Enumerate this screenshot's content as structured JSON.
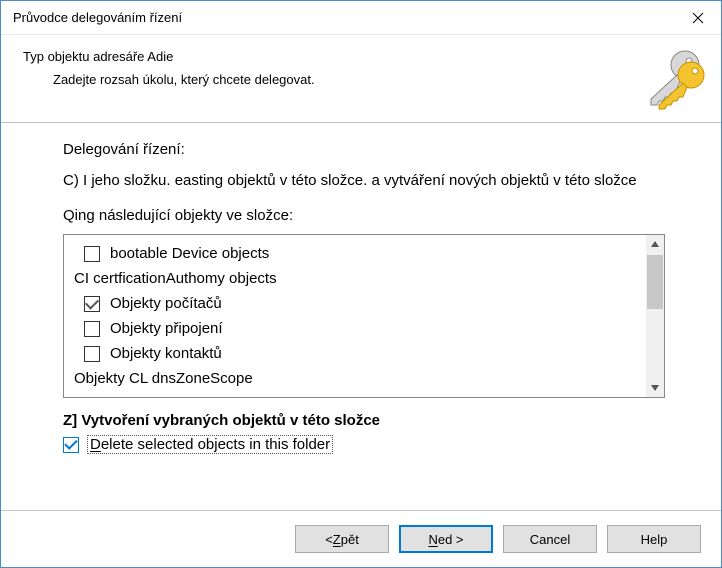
{
  "titlebar": {
    "title": "Průvodce delegováním řízení"
  },
  "header": {
    "title": "Typ objektu adresáře Adie",
    "subtitle": "Zadejte rozsah úkolu, který chcete delegovat."
  },
  "content": {
    "line1": "Delegování řízení:",
    "line2": "C) I jeho složku. easting objektů v této složce. a vytváření nových objektů v této složce",
    "line3": "Qing následující objekty ve složce:",
    "list": [
      {
        "label": "bootable Device objects",
        "checked": false,
        "has_cb": true
      },
      {
        "label": "CI certficationAuthomy objects",
        "checked": false,
        "has_cb": false
      },
      {
        "label": "Objekty počítačů",
        "checked": true,
        "has_cb": true
      },
      {
        "label": "Objekty připojení",
        "checked": false,
        "has_cb": true
      },
      {
        "label": "Objekty kontaktů",
        "checked": false,
        "has_cb": true
      },
      {
        "label": "Objekty CL dnsZoneScope",
        "checked": false,
        "has_cb": false
      }
    ],
    "create_label": "Z] Vytvoření vybraných objektů v této složce",
    "delete_checked": true
  },
  "buttons": {
    "back_pre": "< ",
    "back_mn": "Z",
    "back_post": "pět",
    "next_mn": "N",
    "next_post": "ed &gt;",
    "cancel": "Cancel",
    "help": "Help"
  },
  "delete_label": {
    "mn": "D",
    "rest": "elete selected objects in this folder"
  }
}
